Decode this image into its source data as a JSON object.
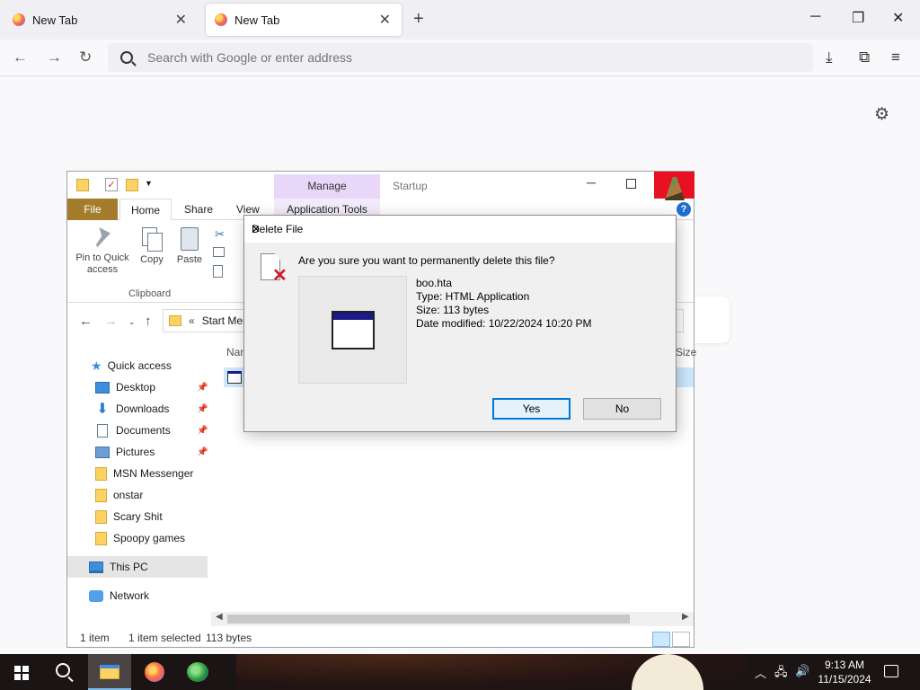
{
  "browser": {
    "tabs": [
      {
        "label": "New Tab"
      },
      {
        "label": "New Tab"
      }
    ],
    "new_tab": "+",
    "address_placeholder": "Search with Google or enter address"
  },
  "explorer": {
    "title": "Startup",
    "manage_tab": "Manage",
    "ribbon_tabs": {
      "file": "File",
      "home": "Home",
      "share": "Share",
      "view": "View",
      "app_tools": "Application Tools"
    },
    "ribbon_buttons": {
      "pin": "Pin to Quick access",
      "copy": "Copy",
      "paste": "Paste"
    },
    "ribbon_group": "Clipboard",
    "address_path": "Start Men",
    "column_headers": {
      "name": "Nam",
      "size": "Size"
    },
    "sidebar": {
      "quick_access": "Quick access",
      "items": [
        {
          "label": "Desktop",
          "icon": "desktop-icon",
          "pinned": true
        },
        {
          "label": "Downloads",
          "icon": "downloads-icon",
          "pinned": true
        },
        {
          "label": "Documents",
          "icon": "documents-icon",
          "pinned": true
        },
        {
          "label": "Pictures",
          "icon": "pictures-icon",
          "pinned": true
        },
        {
          "label": "MSN Messenger",
          "icon": "folder-icon"
        },
        {
          "label": "onstar",
          "icon": "folder-icon"
        },
        {
          "label": "Scary Shit",
          "icon": "folder-icon"
        },
        {
          "label": "Spoopy games",
          "icon": "folder-icon"
        }
      ],
      "this_pc": "This PC",
      "network": "Network"
    },
    "status": {
      "items": "1 item",
      "selected": "1 item selected",
      "size": "113 bytes"
    }
  },
  "dialog": {
    "title": "Delete File",
    "question": "Are you sure you want to permanently delete this file?",
    "file": {
      "name": "boo.hta",
      "type": "Type: HTML Application",
      "size": "Size: 113 bytes",
      "modified": "Date modified: 10/22/2024 10:20 PM"
    },
    "yes": "Yes",
    "no": "No"
  },
  "taskbar": {
    "time": "9:13 AM",
    "date": "11/15/2024"
  },
  "colors": {
    "accent": "#0078d7",
    "close_red": "#e81123",
    "file_tab": "#a47c2b",
    "manage_tab": "#e9d7f9",
    "selection": "#cce8ff"
  }
}
